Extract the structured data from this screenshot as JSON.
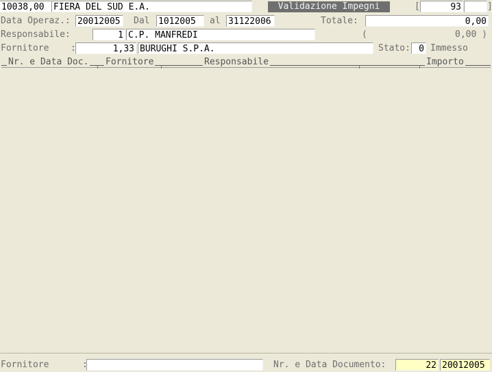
{
  "header": {
    "code": "10038,00",
    "company": "FIERA DEL SUD E.A.",
    "screen_title": "Validazione Impegni",
    "bracket_open": "[",
    "counter": "93",
    "bracket_close": "]"
  },
  "row2": {
    "data_label": "Data Operaz.:",
    "data_value": "20012005",
    "dal_label": "Dal",
    "dal_value": "1012005",
    "al_label": "al",
    "al_value": "31122006",
    "totale_label": "Totale:",
    "totale_value": "0,00"
  },
  "row3": {
    "resp_label": "Responsabile:",
    "resp_code": "1",
    "resp_name": "C.P. MANFREDI",
    "paren_open": "(",
    "paren_value": "0,00 )"
  },
  "row4": {
    "forn_label": "Fornitore",
    "forn_colon": ":",
    "forn_code": "1,33",
    "forn_name": "BURUGHI S.P.A.",
    "stato_label": "Stato:",
    "stato_value": "0",
    "stato_text": "Immesso"
  },
  "columns": {
    "col1": "Nr. e Data Doc.",
    "col2": "Fornitore",
    "col3": "Responsabile",
    "col4": "Importo"
  },
  "footer": {
    "forn_label": "Fornitore",
    "forn_colon": ":",
    "forn_value": "",
    "doc_label": "Nr. e Data Documento:",
    "doc_nr": "22",
    "doc_date": "20012005"
  }
}
